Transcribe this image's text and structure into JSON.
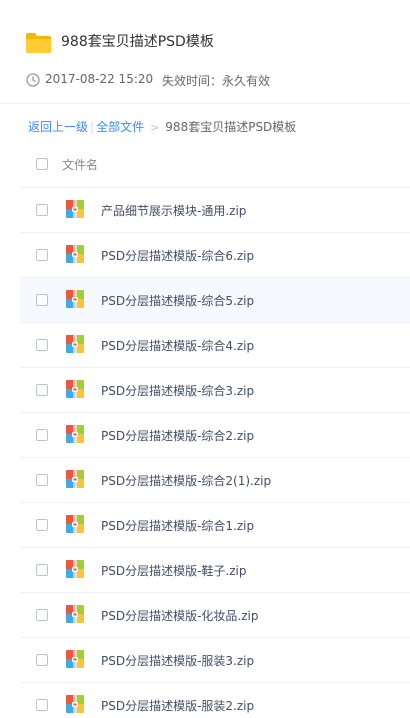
{
  "share": {
    "title": "988套宝贝描述PSD模板",
    "date": "2017-08-22 15:20",
    "expire": "失效时间：永久有效"
  },
  "breadcrumb": {
    "back": "返回上一级",
    "separator": "|",
    "all_files": "全部文件",
    "arrow": ">",
    "current": "988套宝贝描述PSD模板"
  },
  "list": {
    "header_label": "文件名",
    "files": [
      {
        "name": "产品细节展示模块-通用.zip"
      },
      {
        "name": "PSD分层描述模版-综合6.zip"
      },
      {
        "name": "PSD分层描述模版-综合5.zip"
      },
      {
        "name": "PSD分层描述模版-综合4.zip"
      },
      {
        "name": "PSD分层描述模版-综合3.zip"
      },
      {
        "name": "PSD分层描述模版-综合2.zip"
      },
      {
        "name": "PSD分层描述模版-综合2(1).zip"
      },
      {
        "name": "PSD分层描述模版-综合1.zip"
      },
      {
        "name": "PSD分层描述模版-鞋子.zip"
      },
      {
        "name": "PSD分层描述模版-化妆品.zip"
      },
      {
        "name": "PSD分层描述模版-服装3.zip"
      },
      {
        "name": "PSD分层描述模版-服装2.zip"
      }
    ]
  },
  "icons": {
    "folder": "folder-icon",
    "clock": "clock-icon",
    "file": "zip-archive-icon"
  },
  "colors": {
    "link": "#3b8cff",
    "folder": "#ffc933",
    "highlight_row": "#f6f9fd"
  }
}
